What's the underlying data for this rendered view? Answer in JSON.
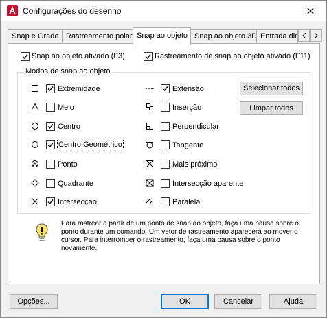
{
  "window": {
    "title": "Configurações do desenho",
    "close_icon": "close-icon"
  },
  "tabs": [
    {
      "label": "Snap e Grade"
    },
    {
      "label": "Rastreamento polar"
    },
    {
      "label": "Snap ao objeto",
      "active": true
    },
    {
      "label": "Snap ao objeto 3D"
    },
    {
      "label": "Entrada din"
    }
  ],
  "top_options": {
    "snap_on": {
      "label": "Snap ao objeto ativado (F3)",
      "checked": true
    },
    "tracking_on": {
      "label": "Rastreamento de snap ao objeto ativado (F11)",
      "checked": true
    }
  },
  "group": {
    "title": "Modos de snap ao objeto",
    "left_modes": [
      {
        "label": "Extremidade",
        "checked": true,
        "icon": "square-endpoint-icon"
      },
      {
        "label": "Meio",
        "checked": false,
        "icon": "triangle-midpoint-icon"
      },
      {
        "label": "Centro",
        "checked": true,
        "icon": "circle-center-icon"
      },
      {
        "label": "Centro Geométrico",
        "checked": true,
        "icon": "circle-geometric-center-icon"
      },
      {
        "label": "Ponto",
        "checked": false,
        "icon": "node-point-icon"
      },
      {
        "label": "Quadrante",
        "checked": false,
        "icon": "diamond-quadrant-icon"
      },
      {
        "label": "Intersecção",
        "checked": true,
        "icon": "x-intersection-icon"
      }
    ],
    "right_modes": [
      {
        "label": "Extensão",
        "checked": true,
        "icon": "dashed-extension-icon"
      },
      {
        "label": "Inserção",
        "checked": false,
        "icon": "insertion-icon"
      },
      {
        "label": "Perpendicular",
        "checked": false,
        "icon": "perpendicular-icon"
      },
      {
        "label": "Tangente",
        "checked": false,
        "icon": "tangent-icon"
      },
      {
        "label": "Mais próximo",
        "checked": false,
        "icon": "hourglass-nearest-icon"
      },
      {
        "label": "Intersecção aparente",
        "checked": false,
        "icon": "boxed-x-apparent-intersection-icon"
      },
      {
        "label": "Paralela",
        "checked": false,
        "icon": "parallel-icon"
      }
    ],
    "select_all": "Selecionar todos",
    "clear_all": "Limpar todos"
  },
  "info": {
    "icon": "lightbulb-icon",
    "text": "Para rastrear a partir de um ponto de snap ao objeto, faça uma pausa sobre o ponto durante um comando. Um vetor de rastreamento aparecerá ao mover o cursor. Para interromper o rastreamento, faça uma pausa sobre o ponto novamente."
  },
  "footer": {
    "options": "Opções...",
    "ok": "OK",
    "cancel": "Cancelar",
    "help": "Ajuda"
  },
  "colors": {
    "app_icon_red": "#c8102e",
    "accent_blue": "#0078d7"
  }
}
